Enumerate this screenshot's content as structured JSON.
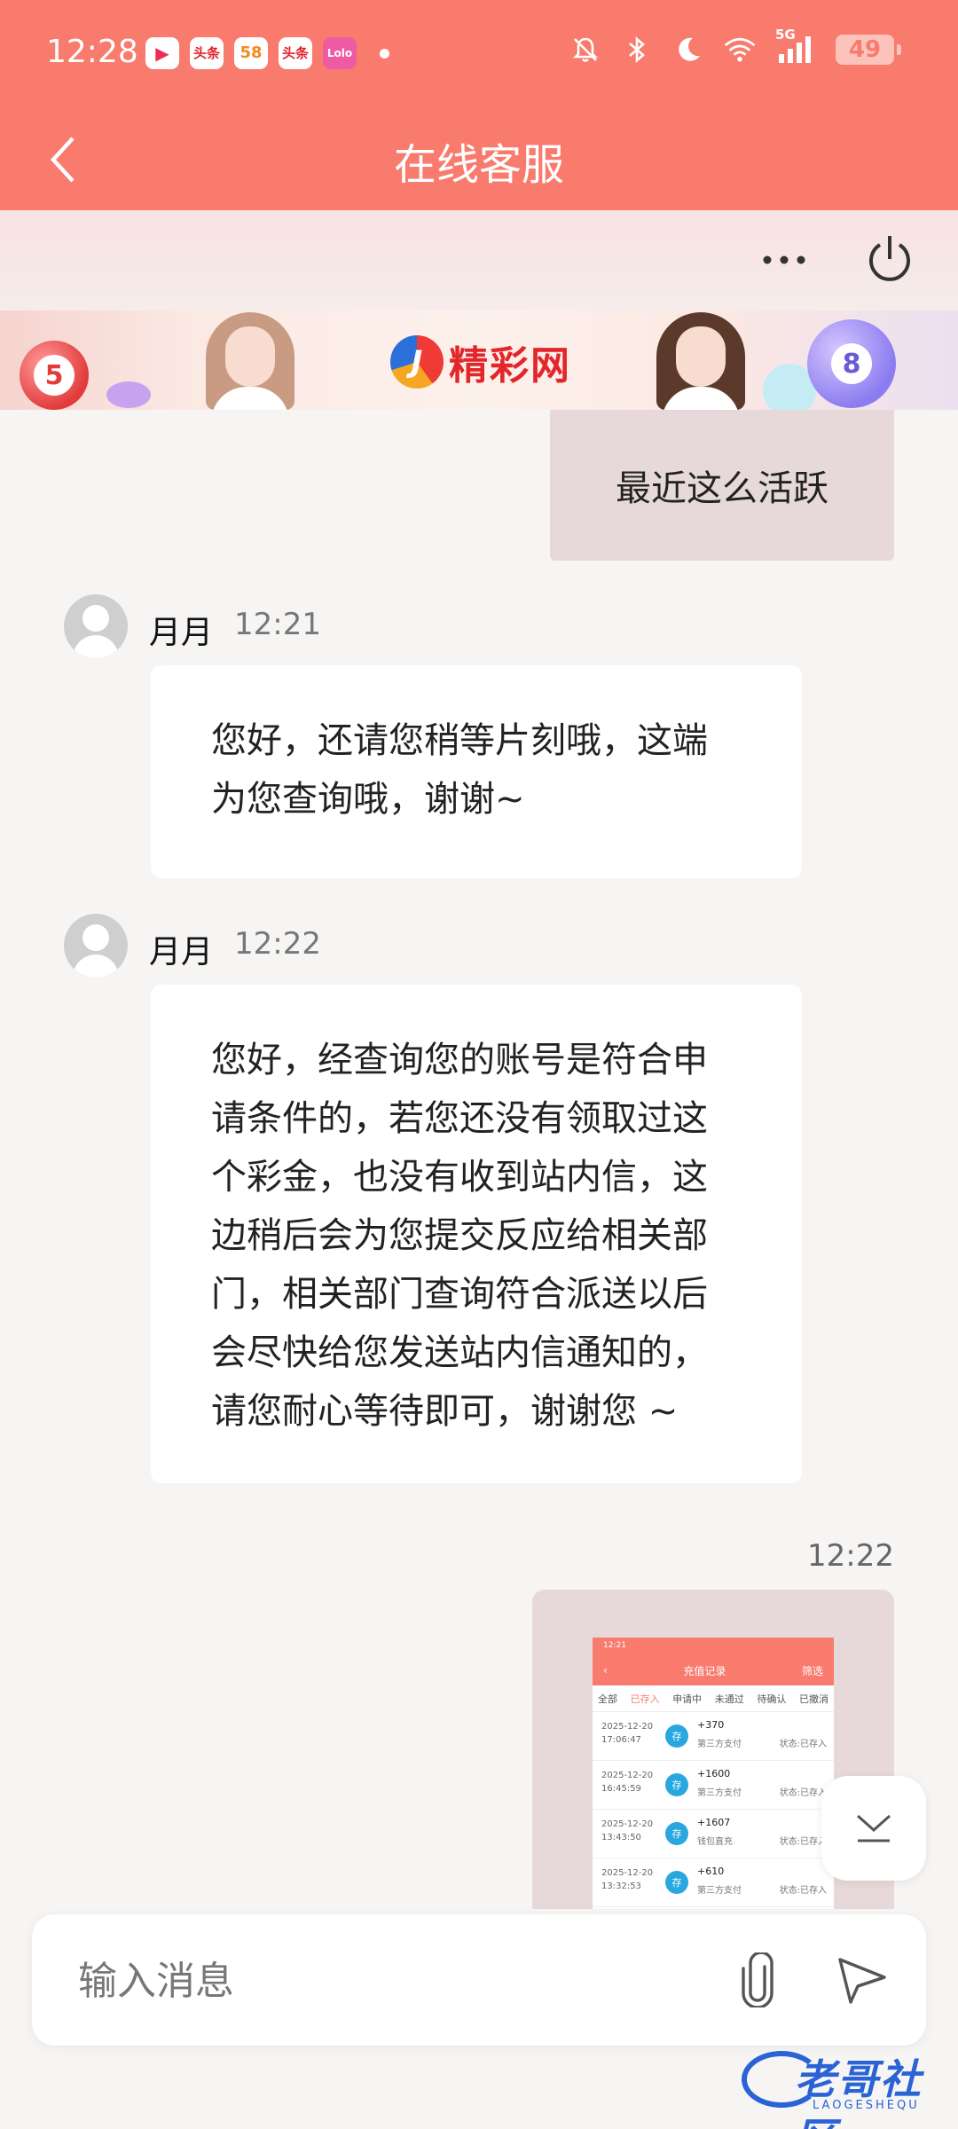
{
  "status_bar": {
    "time": "12:28",
    "apps": [
      {
        "icon": "video-app-icon",
        "label": "▶"
      },
      {
        "icon": "toutiao-app-icon",
        "label": "头条"
      },
      {
        "icon": "58-app-icon",
        "label": "58"
      },
      {
        "icon": "toutiao-lite-app-icon",
        "label": "头条"
      },
      {
        "icon": "pink-app-icon",
        "label": "Lolo"
      }
    ],
    "network": "5G",
    "battery": "49"
  },
  "nav": {
    "title": "在线客服"
  },
  "banner": {
    "brand_mark": "J",
    "brand_name": "精彩网",
    "ball_left": "5",
    "ball_right": "8"
  },
  "messages": {
    "outgoing_1": "最近这么活跃",
    "agent_1": {
      "name": "月月",
      "time": "12:21",
      "text": "您好，还请您稍等片刻哦，这端为您查询哦，谢谢~"
    },
    "agent_2": {
      "name": "月月",
      "time": "12:22",
      "text": "您好，经查询您的账号是符合申请条件的，若您还没有领取过这个彩金，也没有收到站内信，这边稍后会为您提交反应给相关部门，相关部门查询符合派送以后会尽快给您发送站内信通知的，请您耐心等待即可，谢谢您 ~"
    },
    "outgoing_2_time": "12:22"
  },
  "image_preview": {
    "status_time": "12:21",
    "title": "充值记录",
    "filter": "筛选",
    "tabs": [
      "全部",
      "已存入",
      "申请中",
      "未通过",
      "待确认",
      "已撤消"
    ],
    "rows": [
      {
        "date": "2025-12-20",
        "clock": "17:06:47",
        "badge": "存",
        "amount": "+370",
        "method": "第三方支付",
        "status": "状态:已存入"
      },
      {
        "date": "2025-12-20",
        "clock": "16:45:59",
        "badge": "存",
        "amount": "+1600",
        "method": "第三方支付",
        "status": "状态:已存入"
      },
      {
        "date": "2025-12-20",
        "clock": "13:43:50",
        "badge": "存",
        "amount": "+1607",
        "method": "钱包直充",
        "status": "状态:已存入"
      },
      {
        "date": "2025-12-20",
        "clock": "13:32:53",
        "badge": "存",
        "amount": "+610",
        "method": "第三方支付",
        "status": "状态:已存入"
      }
    ]
  },
  "input": {
    "placeholder": "输入消息"
  },
  "watermark": {
    "text": "老哥社区",
    "sub": "LAOGESHEQU"
  },
  "colors": {
    "header": "#f87b6e",
    "outgoing_bubble": "#e7d9d9",
    "incoming_bubble": "#ffffff",
    "watermark": "#2a63d6"
  }
}
